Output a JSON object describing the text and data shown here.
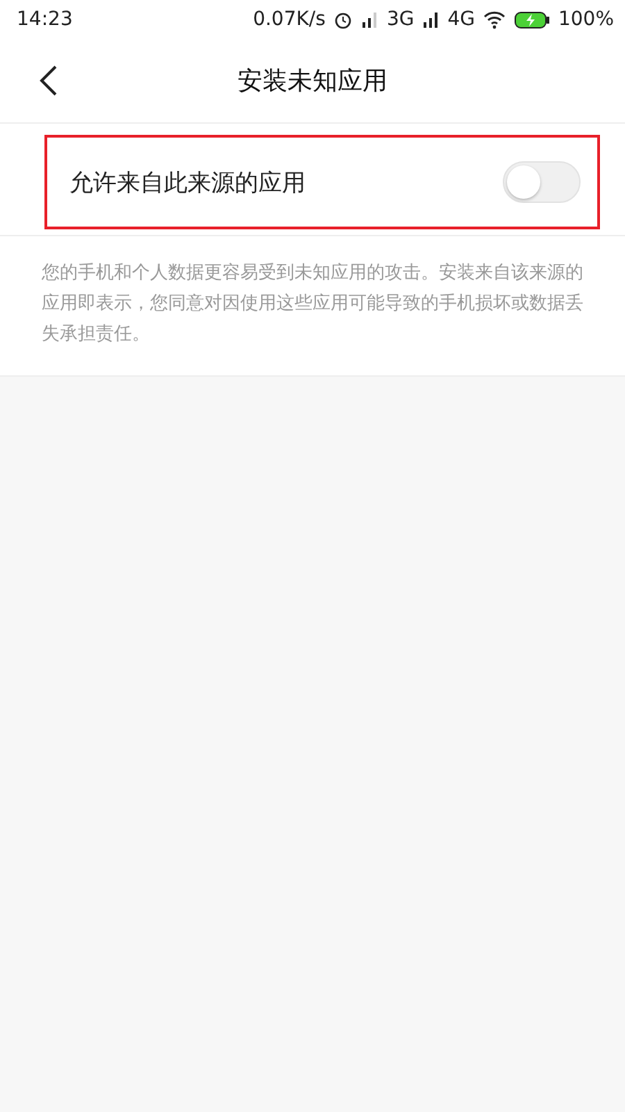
{
  "status_bar": {
    "time": "14:23",
    "speed": "0.07K/s",
    "network_1": "3G",
    "network_2": "4G",
    "battery": "100%"
  },
  "header": {
    "title": "安装未知应用"
  },
  "setting": {
    "label": "允许来自此来源的应用",
    "on": false,
    "highlighted": true
  },
  "description": "您的手机和个人数据更容易受到未知应用的攻击。安装来自该来源的应用即表示，您同意对因使用这些应用可能导致的手机损坏或数据丢失承担责任。"
}
